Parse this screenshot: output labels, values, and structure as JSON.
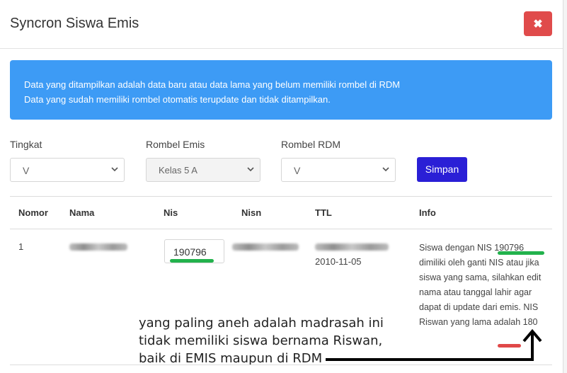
{
  "modal": {
    "title": "Syncron Siswa Emis",
    "close_label": "✖"
  },
  "alert": {
    "line1": "Data yang ditampilkan adalah data baru atau data lama yang belum memiliki rombel di RDM",
    "line2": "Data yang sudah memiliki rombel otomatis terupdate dan tidak ditampilkan."
  },
  "filters": {
    "tingkat_label": "Tingkat",
    "tingkat_value": "V",
    "rombel_emis_label": "Rombel Emis",
    "rombel_emis_value": "Kelas 5 A",
    "rombel_rdm_label": "Rombel RDM",
    "rombel_rdm_value": "V",
    "save_label": "Simpan"
  },
  "table": {
    "headers": [
      "Nomor",
      "Nama",
      "Nis",
      "Nisn",
      "TTL",
      "Info"
    ],
    "rows": [
      {
        "nomor": "1",
        "nis": "190796",
        "ttl_date": "2010-11-05",
        "info": "Siswa dengan NIS 190796 dimiliki oleh ganti NIS atau jika siswa yang sama, silahkan edit nama atau tanggal lahir agar dapat di update dari emis. NIS Riswan yang lama adalah 180"
      }
    ]
  },
  "annotation": {
    "line1": "yang paling aneh adalah madrasah ini",
    "line2": "tidak memiliki siswa bernama Riswan,",
    "line3": "baik di EMIS maupun di RDM"
  },
  "colors": {
    "alert": "#3d9bf5",
    "save_button": "#2a1fd6",
    "close_button": "#e04b4b",
    "green_mark": "#22b24c",
    "red_mark": "#e04848"
  }
}
